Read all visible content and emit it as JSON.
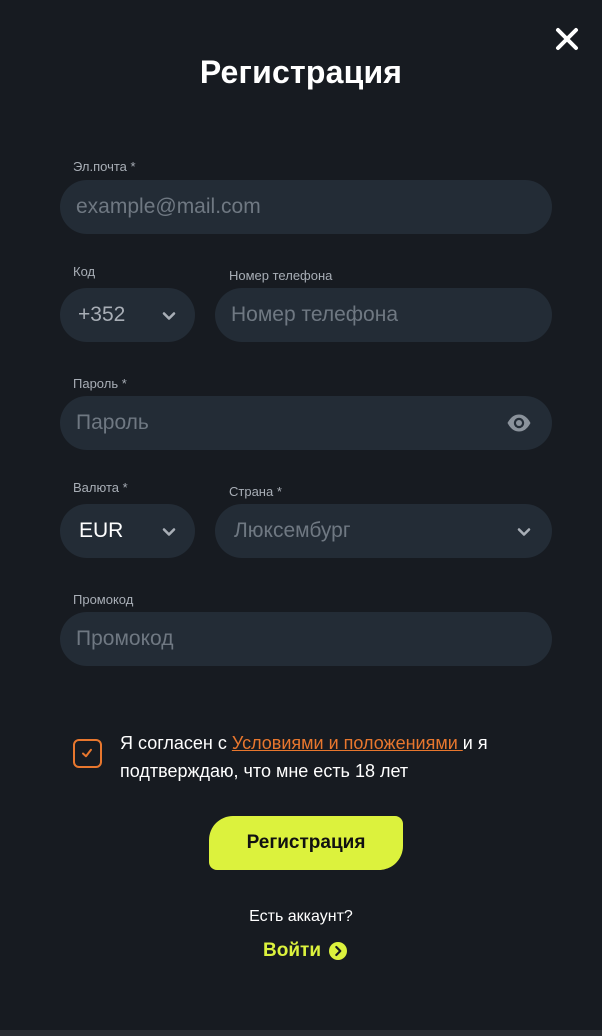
{
  "modal": {
    "title": "Регистрация",
    "close_icon": "close-icon"
  },
  "form": {
    "email": {
      "label": "Эл.почта *",
      "placeholder": "example@mail.com",
      "value": ""
    },
    "code": {
      "label": "Код",
      "value": "+352",
      "icon": "chevron-down-icon"
    },
    "phone": {
      "label": "Номер телефона",
      "placeholder": "Номер телефона",
      "value": ""
    },
    "password": {
      "label": "Пароль *",
      "placeholder": "Пароль",
      "value": "",
      "icon": "eye-icon"
    },
    "currency": {
      "label": "Валюта *",
      "value": "EUR",
      "icon": "chevron-down-icon"
    },
    "country": {
      "label": "Страна *",
      "value": "Люксембург",
      "icon": "chevron-down-icon"
    },
    "promo": {
      "label": "Промокод",
      "placeholder": "Промокод",
      "value": ""
    }
  },
  "agreement": {
    "checked": true,
    "text_before": "Я согласен с ",
    "link_text": "Условиями и положениями ",
    "text_after": "и я подтверждаю, что мне есть 18 лет"
  },
  "submit_label": "Регистрация",
  "login": {
    "prompt": "Есть аккаунт?",
    "link_label": "Войти",
    "icon": "chevron-right-circle-icon"
  },
  "colors": {
    "background": "#171b21",
    "field_bg": "#232c36",
    "accent": "#dcf23d",
    "link": "#e8772e"
  }
}
